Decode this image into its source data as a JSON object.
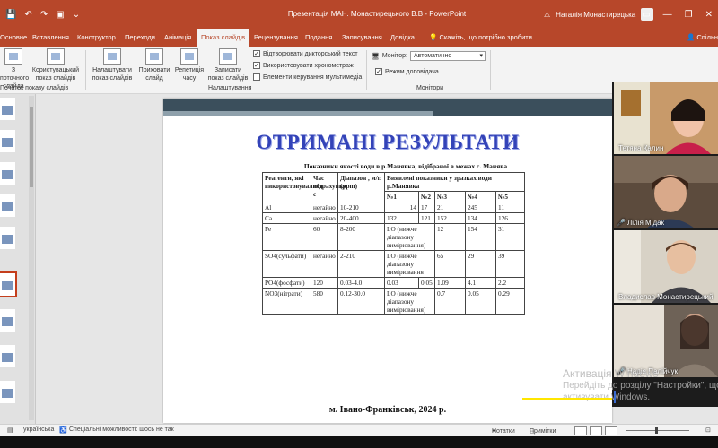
{
  "window": {
    "title": "Презентація МАН. Монастирецького В.В  -  PowerPoint",
    "user": "Наталія Монастирецька",
    "qat": {
      "save": "💾",
      "undo": "↶",
      "redo": "↷",
      "start": "▣",
      "more": "⌄"
    },
    "controls": {
      "options": "▭",
      "minimize": "—",
      "maximize": "❐",
      "close": "✕"
    }
  },
  "tabs": [
    {
      "label": "Основне"
    },
    {
      "label": "Вставлення"
    },
    {
      "label": "Конструктор"
    },
    {
      "label": "Переходи"
    },
    {
      "label": "Анімація"
    },
    {
      "label": "Показ слайдів"
    },
    {
      "label": "Рецензування"
    },
    {
      "label": "Подання"
    },
    {
      "label": "Записування"
    },
    {
      "label": "Довідка"
    }
  ],
  "tellme": "Скажіть, що потрібно зробити",
  "share": "Спільн",
  "ribbon": {
    "from_current": "З поточного слайда",
    "custom_show": "Користувацький показ слайдів",
    "setup_show": "Налаштувати показ слайдів",
    "hide_slide": "Приховати слайд",
    "rehearse": "Репетиція часу",
    "record": "Записати показ слайдів",
    "group_start": "Початок показу слайдів",
    "group_setup": "Налаштування",
    "group_monitors": "Монітори",
    "play_narrations": "Відтворювати дикторський текст",
    "use_timings": "Використовувати хронометраж",
    "show_media_controls": "Елементи керування мультимедіа",
    "monitor_label": "Монітор:",
    "monitor_value": "Автоматично",
    "presenter_view": "Режим доповідача"
  },
  "slide": {
    "title": "ОТРИМАНІ РЕЗУЛЬТАТИ",
    "caption": "Показники якості води в р.Манявка, відібраної в межах  с. Манява",
    "footer": "м. Івано-Франківськ, 2024 р.",
    "table": {
      "headers": {
        "reagent": "Реагенти, які використовувалися",
        "time": "Час підрахунку, с",
        "range": "Діапазон , м/г. (ppm)",
        "detected": "Виявлені показники у зразках води р.Манявка",
        "s1": "№1",
        "s2": "№2",
        "s3": "№3",
        "s4": "№4",
        "s5": "№5"
      },
      "rows": [
        {
          "reagent": "Al",
          "time": "негайно",
          "range": "10-210",
          "s1": "14",
          "s2": "17",
          "s3": "21",
          "s4": "245",
          "s5": "11"
        },
        {
          "reagent": "Ca",
          "time": "негайно",
          "range": "20-400",
          "s1": "132",
          "s2": "121",
          "s3": "152",
          "s4": "134",
          "s5": "126"
        },
        {
          "reagent": "Fe",
          "time": "60",
          "range": "8-200",
          "s12": "LO (нижче діапазону вимірювання)",
          "s3": "12",
          "s4": "154",
          "s5": "31"
        },
        {
          "reagent": "SO4(сульфати)",
          "time": "негайно",
          "range": "2-210",
          "s12": "LO (нижче діапазону вимірювання",
          "s3": "65",
          "s4": "29",
          "s5": "39"
        },
        {
          "reagent": "PO4(фосфати)",
          "time": "120",
          "range": "0.03-4.0",
          "s1": "0.03",
          "s2": "0,05",
          "s3": "1.09",
          "s4": "4.1",
          "s5": "2.2"
        },
        {
          "reagent": "NO3(нітрати)",
          "time": "580",
          "range": "0.12-30.0",
          "s12": "LO (нижче діапазону вимірювання)",
          "s3": "0.7",
          "s4": "0.05",
          "s5": "0.29"
        }
      ]
    }
  },
  "participants": [
    {
      "name": "Тетяна Калин",
      "mic": ""
    },
    {
      "name": "Лілія Мідак",
      "mic": "🎤"
    },
    {
      "name": "Владислав Монастирецький",
      "mic": ""
    },
    {
      "name": "Надія Палійчук",
      "mic": "🎤"
    }
  ],
  "watermark": {
    "title": "Активація Windows",
    "line1": "Перейдіть до розділу \"Настройки\", щоб",
    "line2": "активувати Windows."
  },
  "status": {
    "slide_count": "",
    "language": "українська",
    "accessibility": "Спеціальні можливості: щось не так",
    "notes": "Нотатки",
    "comments": "Примітки"
  },
  "colors": {
    "accent": "#b7472a",
    "title_blue": "#3343b8",
    "band_dark": "#3b4f5c"
  }
}
